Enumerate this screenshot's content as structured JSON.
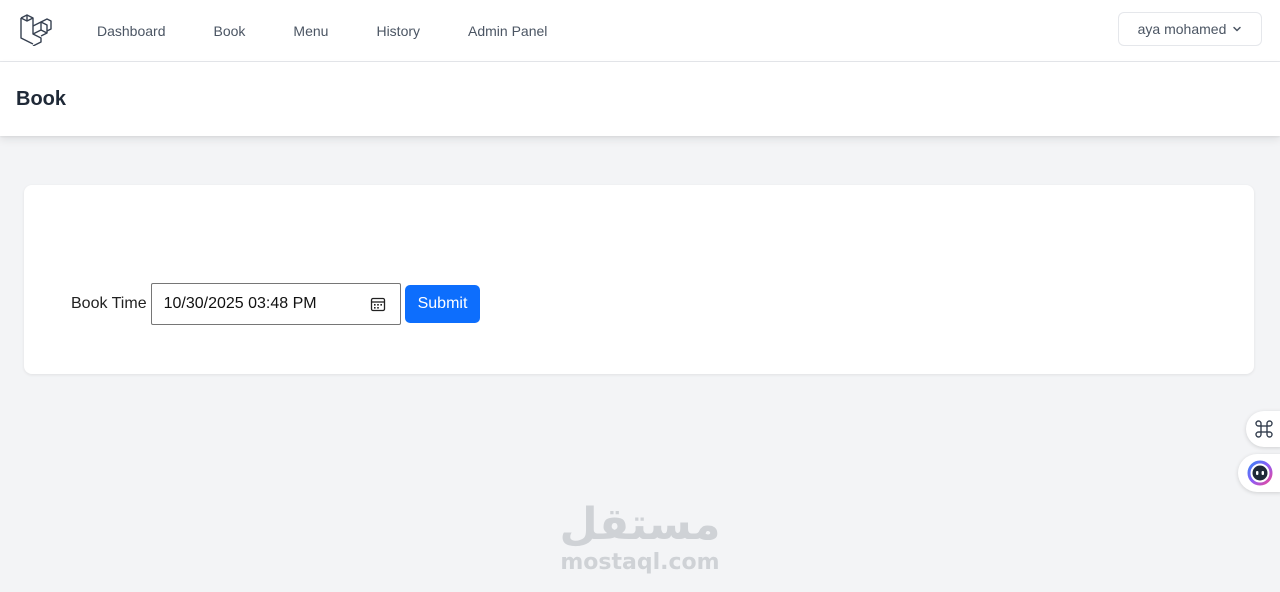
{
  "nav": {
    "links": [
      "Dashboard",
      "Book",
      "Menu",
      "History",
      "Admin Panel"
    ],
    "user_name": "aya mohamed"
  },
  "header": {
    "title": "Book"
  },
  "form": {
    "label": "Book Time",
    "datetime_value": "10/30/2025 03:48  PM",
    "submit_label": "Submit"
  },
  "watermark": {
    "arabic": "مستقل",
    "latin": "mostaql.com"
  },
  "icons": {
    "logo": "laravel-logo-icon",
    "user_menu": "chevron-down-icon",
    "datetime": "calendar-icon",
    "side_one": "command-icon",
    "side_two": "assistant-icon"
  },
  "colors": {
    "accent": "#0d6efd",
    "page_bg": "#f3f4f6"
  }
}
